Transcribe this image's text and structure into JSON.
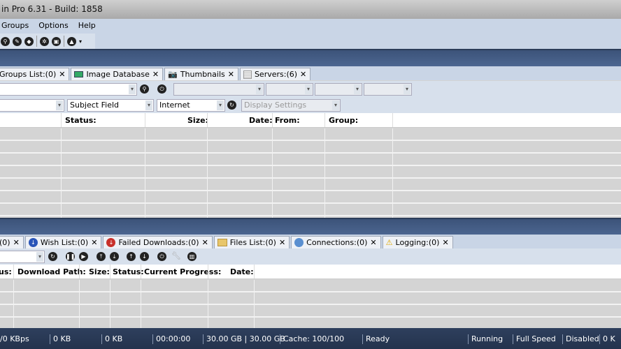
{
  "title": "in Pro 6.31 - Build: 1858",
  "menu": [
    "Groups",
    "Options",
    "Help"
  ],
  "top_tabs": [
    {
      "label": "Groups List:(0)",
      "icon": "none"
    },
    {
      "label": "Image Database",
      "icon": "image-icon"
    },
    {
      "label": "Thumbnails",
      "icon": "camera-icon"
    },
    {
      "label": "Servers:(6)",
      "icon": "server-icon"
    }
  ],
  "filters": {
    "field1": "",
    "subject": "Subject Field",
    "source": "Internet",
    "display_placeholder": "Display Settings"
  },
  "top_columns": [
    "Status:",
    "Size:",
    "Date:",
    "From:",
    "Group:"
  ],
  "bottom_tabs": [
    {
      "label": "(0)"
    },
    {
      "label": "Wish List:(0)"
    },
    {
      "label": "Failed Downloads:(0)"
    },
    {
      "label": "Files List:(0)"
    },
    {
      "label": "Connections:(0)"
    },
    {
      "label": "Logging:(0)"
    }
  ],
  "bottom_columns": [
    "us:",
    "Download Path:",
    "Size:",
    "Status:",
    "Current Progress:",
    "Date:"
  ],
  "status": [
    "/0 KBps",
    "0 KB",
    "0 KB",
    "00:00:00",
    "30.00 GB | 30.00 GB",
    "Cache: 100/100",
    "Ready",
    "Running",
    "Full Speed",
    "Disabled",
    "0 K"
  ]
}
